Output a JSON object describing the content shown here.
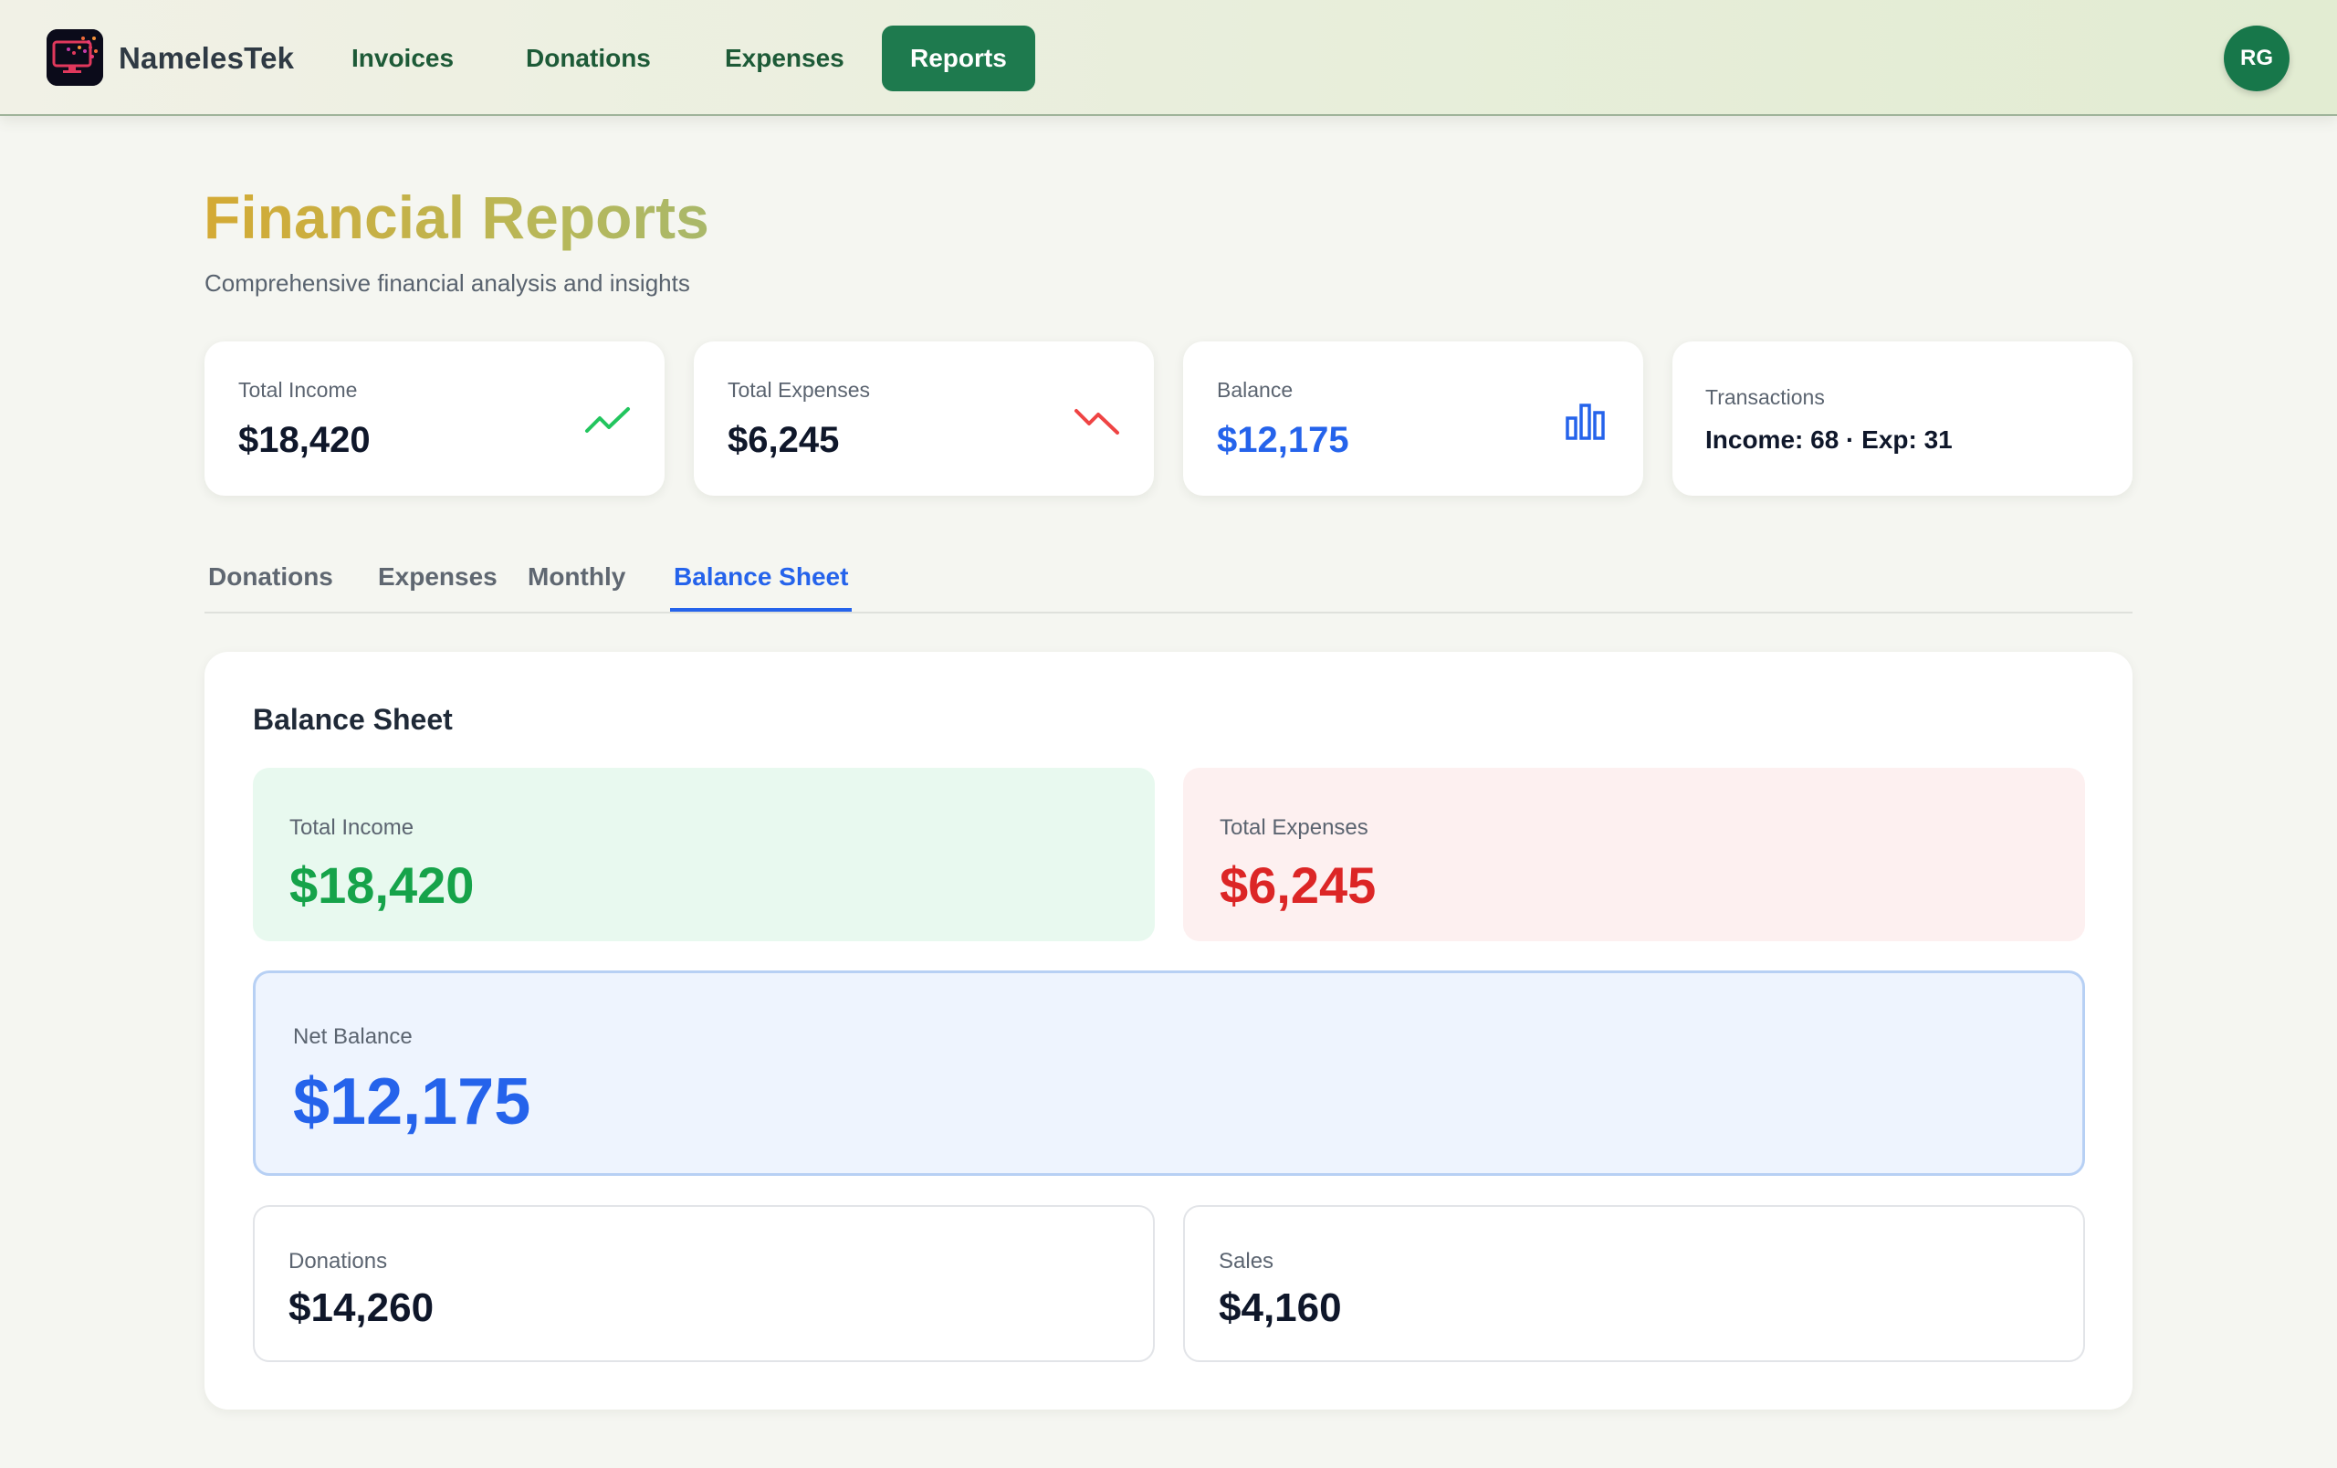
{
  "nav": {
    "brand": "NamelesTek",
    "links": [
      {
        "label": "Invoices"
      },
      {
        "label": "Donations"
      },
      {
        "label": "Expenses"
      },
      {
        "label": "Reports",
        "active": true
      }
    ],
    "avatar_initials": "RG"
  },
  "header": {
    "title": "Financial Reports",
    "subtitle": "Comprehensive financial analysis and insights"
  },
  "stats": {
    "income": {
      "label": "Total Income",
      "value": "$18,420",
      "icon": "trending-up-icon",
      "color": "#22c55e"
    },
    "expenses": {
      "label": "Total Expenses",
      "value": "$6,245",
      "icon": "trending-down-icon",
      "color": "#ef4444"
    },
    "balance": {
      "label": "Balance",
      "value": "$12,175",
      "icon": "bar-chart-icon",
      "color": "#2563eb"
    },
    "transactions": {
      "label": "Transactions",
      "summary": "Income: 68 · Exp: 31"
    }
  },
  "tabs": [
    {
      "label": "Donations"
    },
    {
      "label": "Expenses"
    },
    {
      "label": "Monthly"
    },
    {
      "label": "Balance Sheet",
      "active": true
    }
  ],
  "balance_sheet": {
    "title": "Balance Sheet",
    "total_income": {
      "label": "Total Income",
      "value": "$18,420"
    },
    "total_expenses": {
      "label": "Total Expenses",
      "value": "$6,245"
    },
    "net_balance": {
      "label": "Net Balance",
      "value": "$12,175"
    },
    "donations": {
      "label": "Donations",
      "value": "$14,260"
    },
    "sales": {
      "label": "Sales",
      "value": "$4,160"
    }
  },
  "colors": {
    "accent_green": "#1e7a4e",
    "income_green": "#16a34a",
    "expense_red": "#dc2626",
    "balance_blue": "#2563eb"
  }
}
